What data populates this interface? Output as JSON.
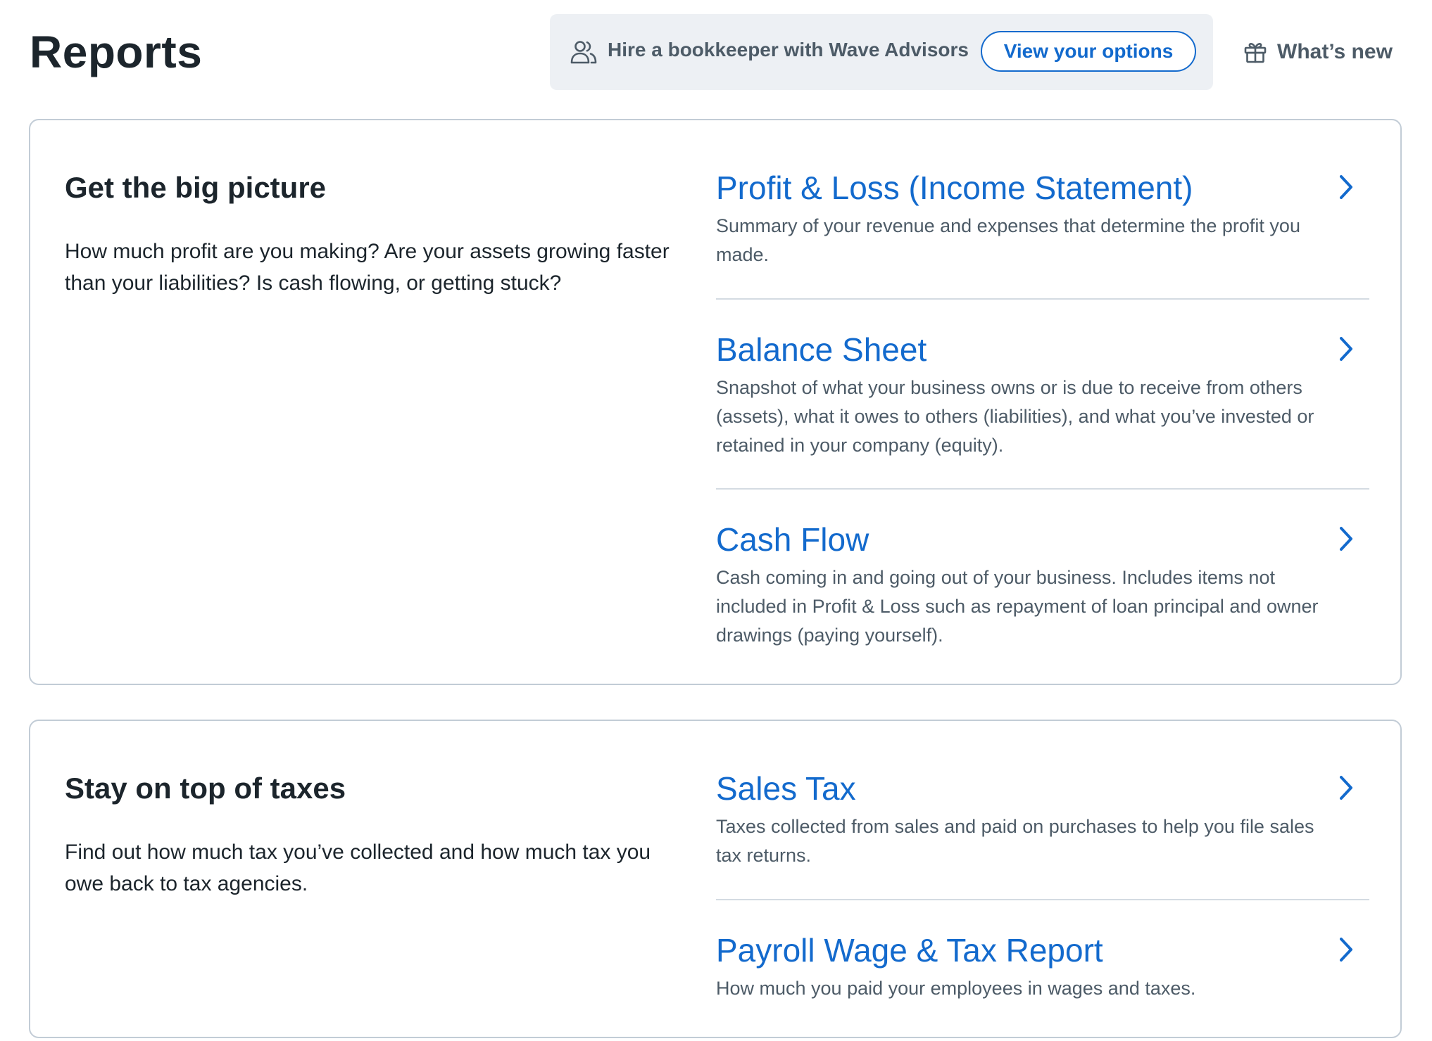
{
  "header": {
    "title": "Reports",
    "advisor_text": "Hire a bookkeeper with Wave Advisors",
    "advisor_button": "View your options",
    "whats_new": "What’s new"
  },
  "icons": {
    "advisor": "people-icon",
    "whats_new": "gift-icon",
    "report_link": "chevron-right-icon"
  },
  "colors": {
    "link_blue": "#136acd",
    "banner_bg": "#edf0f4",
    "card_border": "#c2ccd6",
    "muted_text": "#4d5b67",
    "heading_text": "#1c252c"
  },
  "sections": [
    {
      "heading": "Get the big picture",
      "description": "How much profit are you making? Are your assets growing faster than your liabilities? Is cash flowing, or getting stuck?",
      "reports": [
        {
          "title": "Profit & Loss (Income Statement)",
          "description": "Summary of your revenue and expenses that determine the profit you made."
        },
        {
          "title": "Balance Sheet",
          "description": "Snapshot of what your business owns or is due to receive from others (assets), what it owes to others (liabilities), and what you’ve invested or retained in your company (equity)."
        },
        {
          "title": "Cash Flow",
          "description": "Cash coming in and going out of your business. Includes items not included in Profit & Loss such as repayment of loan principal and owner drawings (paying yourself)."
        }
      ]
    },
    {
      "heading": "Stay on top of taxes",
      "description": "Find out how much tax you’ve collected and how much tax you owe back to tax agencies.",
      "reports": [
        {
          "title": "Sales Tax",
          "description": "Taxes collected from sales and paid on purchases to help you file sales tax returns."
        },
        {
          "title": "Payroll Wage & Tax Report",
          "description": "How much you paid your employees in wages and taxes."
        }
      ]
    }
  ]
}
